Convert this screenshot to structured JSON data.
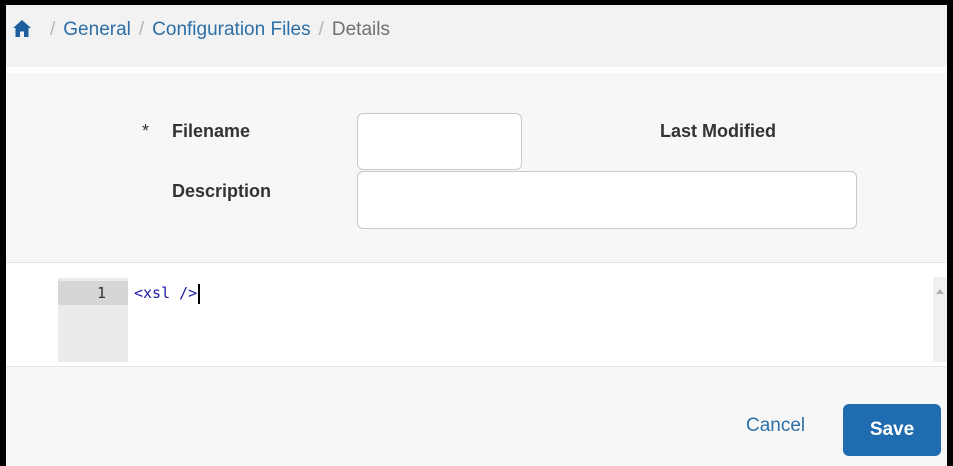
{
  "breadcrumb": {
    "home_icon": "home-icon",
    "separator": "/",
    "items": [
      {
        "label": "General"
      },
      {
        "label": "Configuration Files"
      },
      {
        "label": "Details"
      }
    ]
  },
  "form": {
    "filename": {
      "required_mark": "*",
      "label": "Filename",
      "value": ""
    },
    "last_modified": {
      "label": "Last Modified",
      "value": ""
    },
    "description": {
      "label": "Description",
      "value": ""
    }
  },
  "editor": {
    "line_number": "1",
    "code": "<xsl />"
  },
  "footer": {
    "cancel_label": "Cancel",
    "save_label": "Save"
  },
  "colors": {
    "link": "#2c6fa6",
    "primary_button": "#1f6cb0",
    "code_text": "#1a1aa6"
  }
}
